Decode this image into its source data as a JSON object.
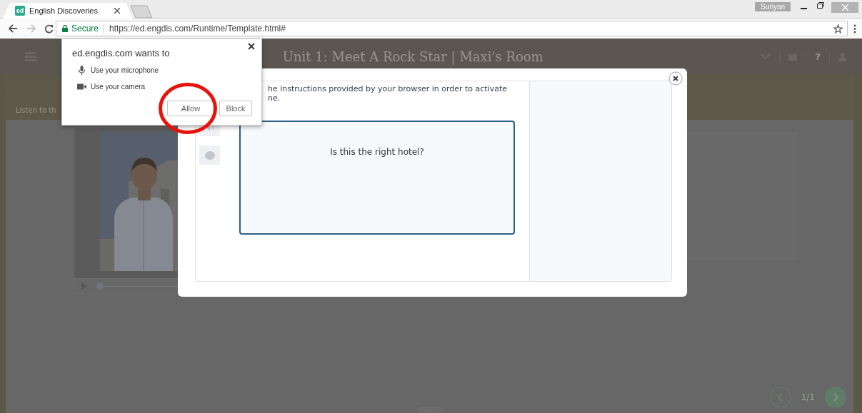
{
  "browser": {
    "favicon": "ed",
    "tab_title": "English Discoveries",
    "user": "Suriyan",
    "secure_label": "Secure",
    "url": "https://ed.engdis.com/Runtime/Template.html#"
  },
  "header": {
    "title": "Unit 1: Meet A Rock Star | Maxi's Room",
    "help_label": "?"
  },
  "instruction": "Listen to th",
  "player": {
    "level": 0
  },
  "modal": {
    "instructions": [
      "he instructions provided by your browser in order to activate",
      "ne."
    ],
    "question": "Is this the right hotel?"
  },
  "permission_popup": {
    "title": "ed.engdis.com wants to",
    "permissions": [
      {
        "kind": "microphone",
        "label": "Use your microphone"
      },
      {
        "kind": "camera",
        "label": "Use your camera"
      }
    ],
    "buttons": [
      "Allow",
      "Block"
    ]
  },
  "pager": {
    "text": "1/1"
  }
}
